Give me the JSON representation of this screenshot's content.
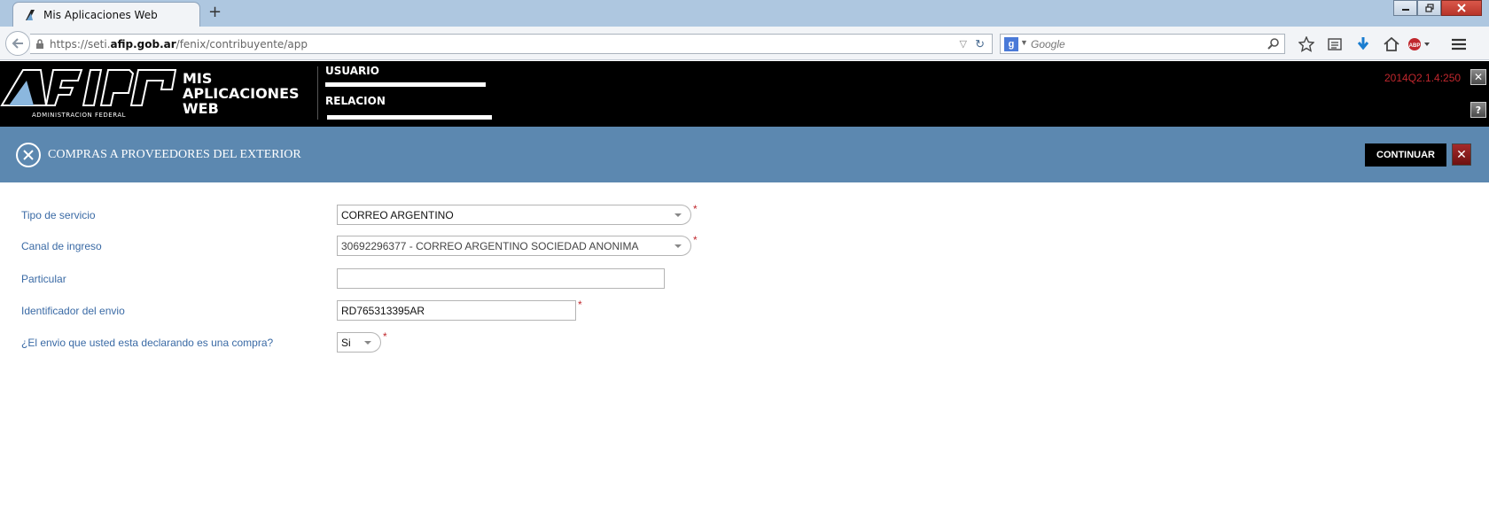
{
  "browser": {
    "tab_title": "Mis Aplicaciones Web",
    "url_prefix": "https://seti.",
    "url_domain": "afip.gob.ar",
    "url_path": "/fenix/contribuyente/app",
    "search_placeholder": "Google",
    "new_tab": "+"
  },
  "header": {
    "logo_text": "ADMINISTRACION FEDERAL",
    "app_title_line1": "MIS",
    "app_title_line2": "APLICACIONES",
    "app_title_line3": "WEB",
    "usuario_label": "USUARIO",
    "relacion_label": "RELACION",
    "version": "2014Q2.1.4:250",
    "close_glyph": "✕",
    "help_glyph": "?"
  },
  "banner": {
    "title": "COMPRAS A PROVEEDORES DEL EXTERIOR",
    "continuar_label": "CONTINUAR",
    "cancel_glyph": "✕"
  },
  "form": {
    "rows": [
      {
        "label": "Tipo de servicio",
        "value": "CORREO ARGENTINO",
        "kind": "select",
        "required": true
      },
      {
        "label": "Canal de ingreso",
        "value": "30692296377 - CORREO ARGENTINO SOCIEDAD ANONIMA",
        "kind": "select",
        "required": true
      },
      {
        "label": "Particular",
        "value": "",
        "kind": "text",
        "required": false
      },
      {
        "label": "Identificador del envio",
        "value": "RD765313395AR",
        "kind": "text",
        "required": true
      },
      {
        "label": "¿El envio que usted esta declarando es una compra?",
        "value": "Si",
        "kind": "select",
        "required": true
      }
    ],
    "required_mark": "*"
  },
  "colors": {
    "banner": "#5c88b0",
    "label": "#3a6aa5",
    "version": "#c0272d"
  }
}
